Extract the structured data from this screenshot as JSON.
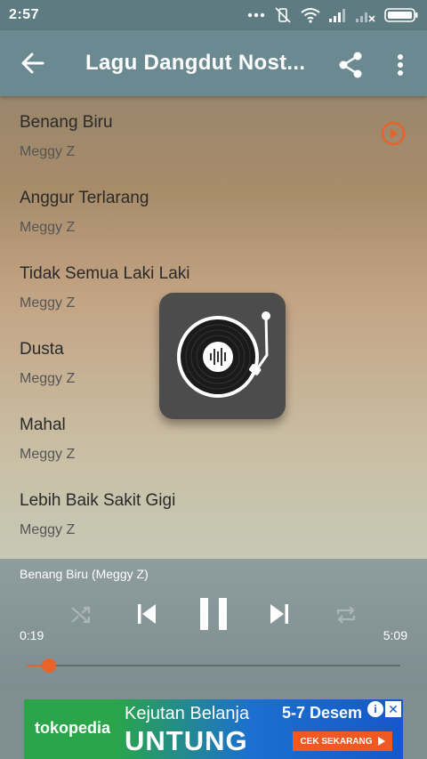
{
  "status_bar": {
    "time": "2:57"
  },
  "app_bar": {
    "title": "Lagu Dangdut Nost..."
  },
  "songs": [
    {
      "title": "Benang Biru",
      "artist": "Meggy Z",
      "playing": true
    },
    {
      "title": "Anggur Terlarang",
      "artist": "Meggy Z",
      "playing": false
    },
    {
      "title": "Tidak Semua Laki Laki",
      "artist": "Meggy Z",
      "playing": false
    },
    {
      "title": "Dusta",
      "artist": "Meggy Z",
      "playing": false
    },
    {
      "title": "Mahal",
      "artist": "Meggy Z",
      "playing": false
    },
    {
      "title": "Lebih Baik Sakit Gigi",
      "artist": "Meggy Z",
      "playing": false
    }
  ],
  "player": {
    "now_playing": "Benang Biru (Meggy Z)",
    "current_time": "0:19",
    "duration": "5:09",
    "progress": 0.06
  },
  "ad": {
    "brand": "tokopedia",
    "line1": "Kejutan Belanja",
    "line2": "UNTUNG",
    "dates": "5-7 Desem",
    "cta": "CEK SEKARANG"
  },
  "colors": {
    "status_bar": "#5d7b80",
    "app_bar": "#6b8990",
    "accent": "#e8622a",
    "player_bg": "#8e9d9f"
  }
}
